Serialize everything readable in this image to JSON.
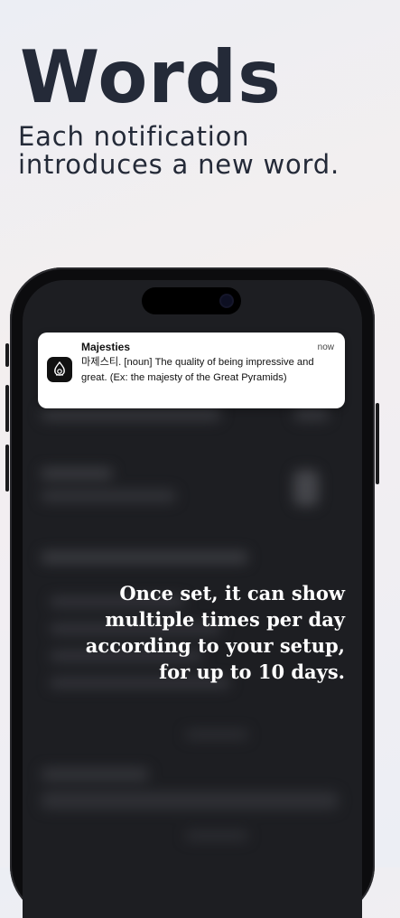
{
  "hero": {
    "title": "Words",
    "subtitle": "Each notification introduces a new word."
  },
  "notification": {
    "app_icon": "app-logo-icon",
    "title": "Majesties",
    "time": "now",
    "body": "마제스티. [noun] The quality of being impressive and great. (Ex: the majesty of the Great Pyramids)"
  },
  "overlay": {
    "line1": "Once set, it can show",
    "line2": "multiple times per day",
    "line3": "according to your setup,",
    "line4": "for up to 10 days."
  },
  "colors": {
    "heading": "#242a38",
    "phone_frame": "#0c0c0e",
    "screen": "#1d1e22",
    "notification_bg": "#ffffff"
  }
}
